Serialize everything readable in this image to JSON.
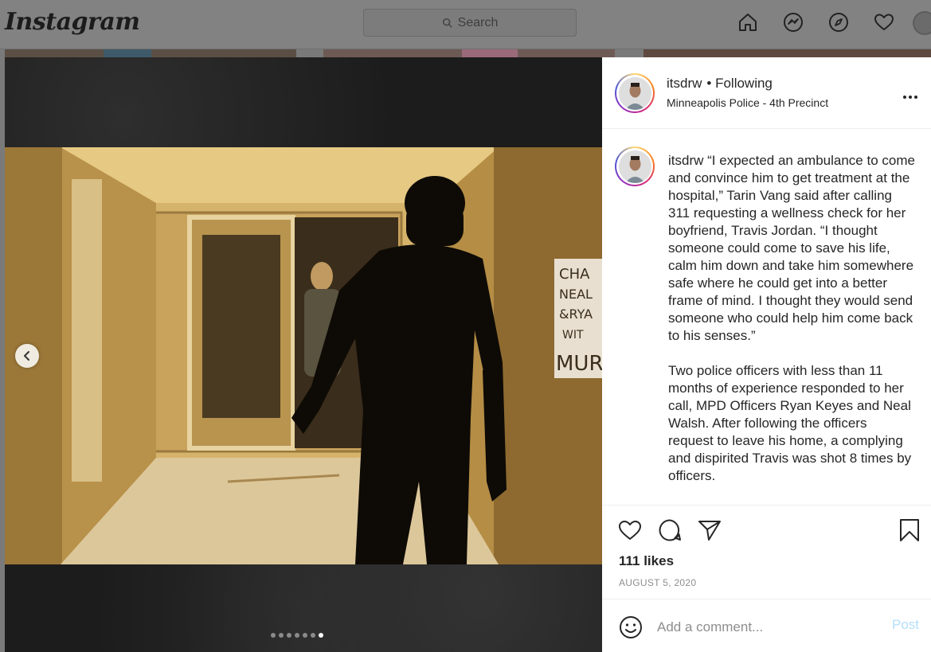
{
  "topbar": {
    "logo": "Instagram",
    "search_placeholder": "Search",
    "icons": [
      "home-icon",
      "messenger-icon",
      "explore-icon",
      "heart-icon"
    ]
  },
  "post": {
    "username": "itsdrw",
    "follow_status": "• Following",
    "location": "Minneapolis Police - 4th Precinct",
    "caption_paragraphs": [
      "“I expected an ambulance to come and convince him to get treatment at the hospital,” Tarin Vang said after calling 311 requesting a wellness check for her boyfriend, Travis Jordan. “I thought someone could come to save his life, calm him down and take him somewhere safe where he could get into a better frame of mind. I thought they would send someone who could help him come back to his senses.”",
      "Two police officers with less than 11 months of experience responded to her call, MPD Officers Ryan Keyes and Neal Walsh. After following the officers request to leave his home, a complying and dispirited Travis was shot 8 times by officers."
    ],
    "likes": "111 likes",
    "date": "AUGUST 5, 2020",
    "carousel": {
      "count": 7,
      "active_index": 6
    }
  },
  "comment": {
    "placeholder": "Add a comment...",
    "post_label": "Post"
  },
  "colors": {
    "post_button": "#b2dffc",
    "photo_tint": "#caa254",
    "backdrop": "#7a7a7a"
  }
}
